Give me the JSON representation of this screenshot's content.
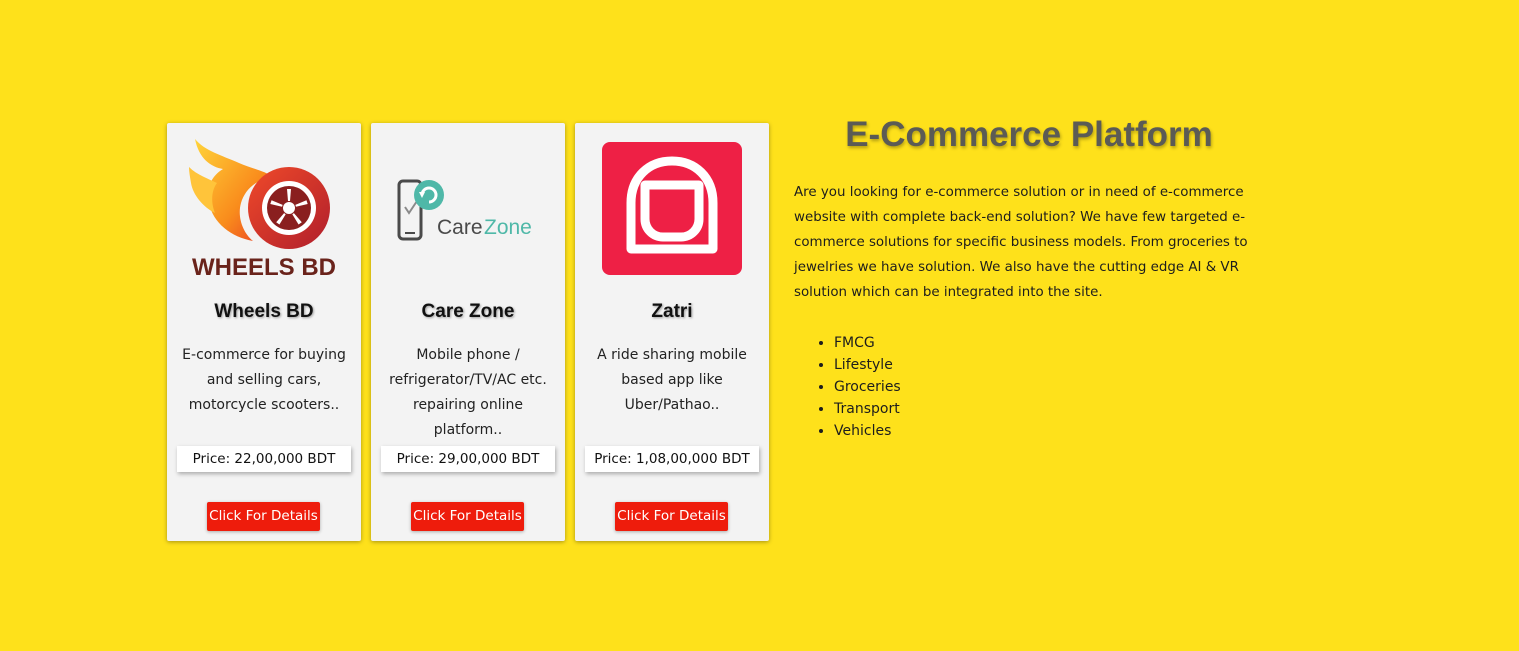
{
  "cards": [
    {
      "logo_icon": "wheels-bd-logo",
      "logo_text": "WHEELS BD",
      "title": "Wheels BD",
      "description": "E-commerce for buying and selling cars, motorcycle scooters..",
      "price": "Price: 22,00,000 BDT",
      "button": "Click For Details"
    },
    {
      "logo_icon": "care-zone-logo",
      "logo_text_part1": "Care",
      "logo_text_part2": "Zone",
      "title": "Care Zone",
      "description": "Mobile phone / refrigerator/TV/AC etc. repairing online platform..",
      "price": "Price: 29,00,000 BDT",
      "button": "Click For Details"
    },
    {
      "logo_icon": "zatri-logo",
      "title": "Zatri",
      "description": "A ride sharing mobile based app like Uber/Pathao..",
      "price": "Price: 1,08,00,000 BDT",
      "button": "Click For Details"
    }
  ],
  "info": {
    "heading": "E-Commerce Platform",
    "paragraph": "Are you looking for e-commerce solution or in need of e-commerce website with complete back-end solution? We have few targeted e-commerce solutions for specific business models. From groceries to jewelries we have solution. We also have the cutting edge AI & VR solution which can be integrated into the site.",
    "list": [
      "FMCG",
      "Lifestyle",
      "Groceries",
      "Transport",
      "Vehicles"
    ]
  },
  "colors": {
    "background": "#fee11b",
    "button": "#ee1c0c",
    "zatri_red": "#ee2045",
    "care_zone_teal": "#4fb8a8",
    "wheels_dark": "#6a231b"
  }
}
